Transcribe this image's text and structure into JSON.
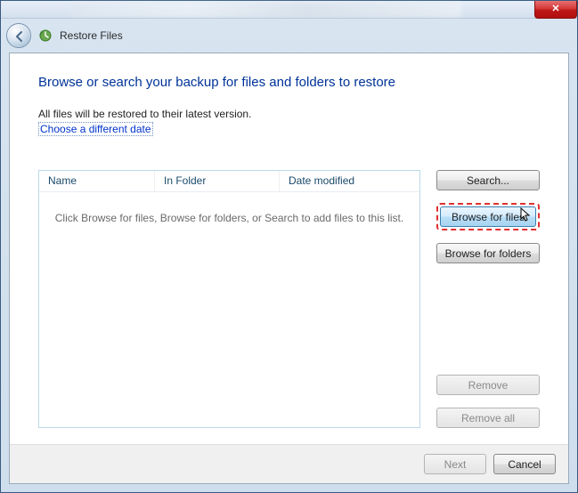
{
  "window": {
    "close_glyph": "✕"
  },
  "header": {
    "title": "Restore Files"
  },
  "main": {
    "heading": "Browse or search your backup for files and folders to restore",
    "subtext": "All files will be restored to their latest version.",
    "link": "Choose a different date"
  },
  "list": {
    "columns": {
      "name": "Name",
      "folder": "In Folder",
      "date": "Date modified"
    },
    "empty_text": "Click Browse for files, Browse for folders, or Search to add files to this list."
  },
  "buttons": {
    "search": "Search...",
    "browse_files": "Browse for files",
    "browse_folders": "Browse for folders",
    "remove": "Remove",
    "remove_all": "Remove all",
    "next": "Next",
    "cancel": "Cancel"
  }
}
